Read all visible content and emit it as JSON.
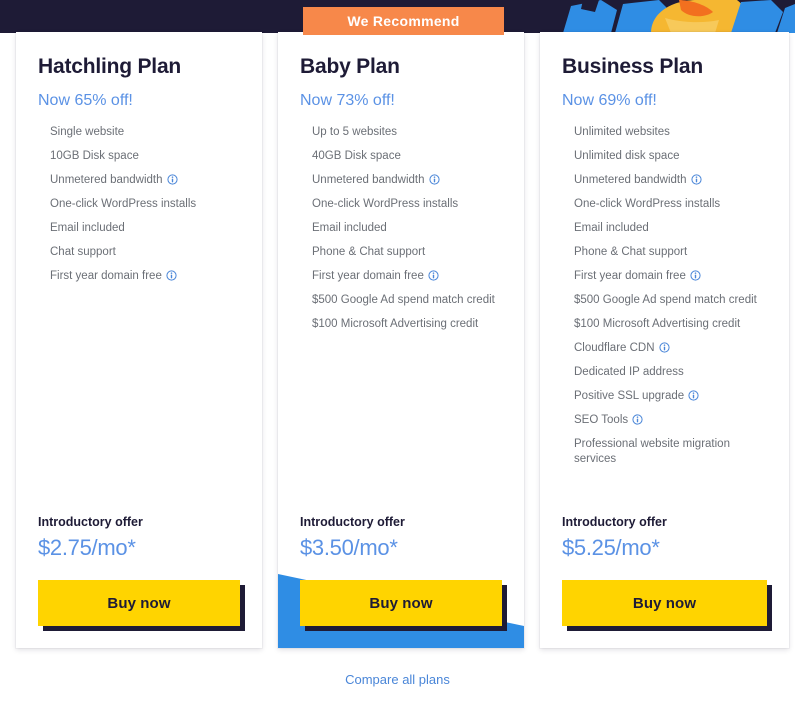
{
  "hero": {
    "background_color": "#1e1b36",
    "art_name": "mascot-illustration"
  },
  "recommend_badge": {
    "label": "We Recommend",
    "color": "#f7884a"
  },
  "colors": {
    "accent_blue": "#5b92e5",
    "link_blue": "#4a86d8",
    "cta_yellow": "#ffd400",
    "navy": "#1e1b36",
    "ribbon_blue": "#2f8de4",
    "badge_orange": "#f7884a",
    "feature_text": "#6b6f76"
  },
  "plans": [
    {
      "id": "hatchling",
      "name": "Hatchling Plan",
      "discount": "Now 65% off!",
      "features": [
        {
          "label": "Single website",
          "info": false
        },
        {
          "label": "10GB Disk space",
          "info": false
        },
        {
          "label": "Unmetered bandwidth",
          "info": true
        },
        {
          "label": "One-click WordPress installs",
          "info": false
        },
        {
          "label": "Email included",
          "info": false
        },
        {
          "label": "Chat support",
          "info": false
        },
        {
          "label": "First year domain free",
          "info": true
        }
      ],
      "offer_label": "Introductory offer",
      "price": "$2.75/mo*",
      "cta_label": "Buy now",
      "recommended": false
    },
    {
      "id": "baby",
      "name": "Baby Plan",
      "discount": "Now 73% off!",
      "features": [
        {
          "label": "Up to 5 websites",
          "info": false
        },
        {
          "label": "40GB Disk space",
          "info": false
        },
        {
          "label": "Unmetered bandwidth",
          "info": true
        },
        {
          "label": "One-click WordPress installs",
          "info": false
        },
        {
          "label": "Email included",
          "info": false
        },
        {
          "label": "Phone & Chat support",
          "info": false
        },
        {
          "label": "First year domain free",
          "info": true
        },
        {
          "label": "$500 Google Ad spend match credit",
          "info": false
        },
        {
          "label": "$100 Microsoft Advertising credit",
          "info": false
        }
      ],
      "offer_label": "Introductory offer",
      "price": "$3.50/mo*",
      "cta_label": "Buy now",
      "recommended": true
    },
    {
      "id": "business",
      "name": "Business Plan",
      "discount": "Now 69% off!",
      "features": [
        {
          "label": "Unlimited websites",
          "info": false
        },
        {
          "label": "Unlimited disk space",
          "info": false
        },
        {
          "label": "Unmetered bandwidth",
          "info": true
        },
        {
          "label": "One-click WordPress installs",
          "info": false
        },
        {
          "label": "Email included",
          "info": false
        },
        {
          "label": "Phone & Chat support",
          "info": false
        },
        {
          "label": "First year domain free",
          "info": true
        },
        {
          "label": "$500 Google Ad spend match credit",
          "info": false
        },
        {
          "label": "$100 Microsoft Advertising credit",
          "info": false
        },
        {
          "label": "Cloudflare CDN",
          "info": true
        },
        {
          "label": "Dedicated IP address",
          "info": false
        },
        {
          "label": "Positive SSL upgrade",
          "info": true
        },
        {
          "label": "SEO Tools",
          "info": true
        },
        {
          "label": "Professional website migration services",
          "info": false
        }
      ],
      "offer_label": "Introductory offer",
      "price": "$5.25/mo*",
      "cta_label": "Buy now",
      "recommended": false
    }
  ],
  "compare_link": {
    "label": "Compare all plans"
  }
}
